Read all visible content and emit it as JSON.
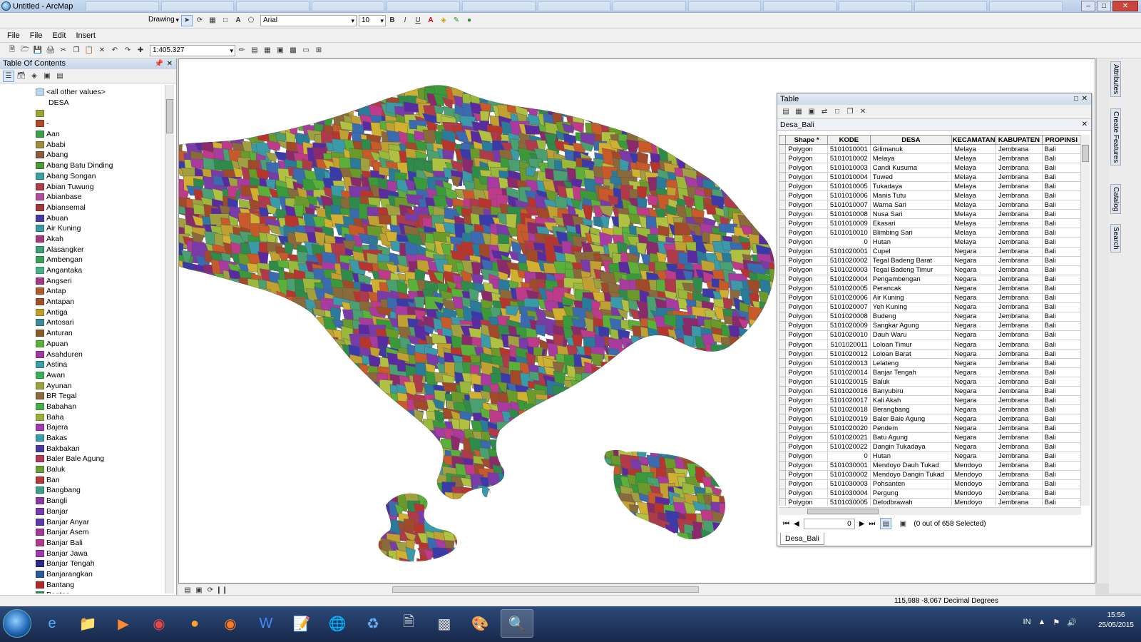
{
  "window": {
    "title": "Untitled - ArcMap"
  },
  "drawing_toolbar": {
    "drawing_label": "Drawing",
    "font_name": "Arial",
    "font_size": "10",
    "bold": "B",
    "italic": "I",
    "underline": "U",
    "text_tool": "A"
  },
  "menu": {
    "items": [
      "File",
      "File",
      "Edit",
      "Insert"
    ]
  },
  "standard_toolbar": {
    "scale": "1:405.327"
  },
  "toc": {
    "title": "Table Of Contents",
    "header_value": "<all other values>",
    "field_name": "DESA",
    "items": [
      {
        "label": "",
        "color": "#9aa53a"
      },
      {
        "label": "-",
        "color": "#b04a2a"
      },
      {
        "label": "Aan",
        "color": "#3aa04a"
      },
      {
        "label": "Ababi",
        "color": "#9a8a3a"
      },
      {
        "label": "Abang",
        "color": "#8a5a3a"
      },
      {
        "label": "Abang Batu Dinding",
        "color": "#4a9a3a"
      },
      {
        "label": "Abang Songan",
        "color": "#3aa0a0"
      },
      {
        "label": "Abian Tuwung",
        "color": "#b03a4a"
      },
      {
        "label": "Abianbase",
        "color": "#b04a9a"
      },
      {
        "label": "Abiansemal",
        "color": "#a03a3a"
      },
      {
        "label": "Abuan",
        "color": "#4a3aa8"
      },
      {
        "label": "Air Kuning",
        "color": "#3a9aa0"
      },
      {
        "label": "Akah",
        "color": "#a03a7a"
      },
      {
        "label": "Alasangker",
        "color": "#3aa07a"
      },
      {
        "label": "Ambengan",
        "color": "#3aa05a"
      },
      {
        "label": "Angantaka",
        "color": "#4ab08a"
      },
      {
        "label": "Angseri",
        "color": "#a03a8a"
      },
      {
        "label": "Antap",
        "color": "#b05a2a"
      },
      {
        "label": "Antapan",
        "color": "#a0502a"
      },
      {
        "label": "Antiga",
        "color": "#c0a02a"
      },
      {
        "label": "Antosari",
        "color": "#3a8a9a"
      },
      {
        "label": "Anturan",
        "color": "#8a5a2a"
      },
      {
        "label": "Apuan",
        "color": "#5ab03a"
      },
      {
        "label": "Asahduren",
        "color": "#a03aa0"
      },
      {
        "label": "Astina",
        "color": "#3aa0a8"
      },
      {
        "label": "Awan",
        "color": "#3ab05a"
      },
      {
        "label": "Ayunan",
        "color": "#9aa03a"
      },
      {
        "label": "BR Tegal",
        "color": "#8a6a3a"
      },
      {
        "label": "Babahan",
        "color": "#4ab04a"
      },
      {
        "label": "Baha",
        "color": "#9ab03a"
      },
      {
        "label": "Bajera",
        "color": "#a03ab0"
      },
      {
        "label": "Bakas",
        "color": "#3a9ab0"
      },
      {
        "label": "Bakbakan",
        "color": "#4a3a9a"
      },
      {
        "label": "Baler Bale Agung",
        "color": "#b03a5a"
      },
      {
        "label": "Baluk",
        "color": "#6aa03a"
      },
      {
        "label": "Ban",
        "color": "#b03a3a"
      },
      {
        "label": "Bangbang",
        "color": "#3aa08a"
      },
      {
        "label": "Bangli",
        "color": "#8a3aa0"
      },
      {
        "label": "Banjar",
        "color": "#7a3ab0"
      },
      {
        "label": "Banjar Anyar",
        "color": "#5a3ab0"
      },
      {
        "label": "Banjar Asem",
        "color": "#a03a9a"
      },
      {
        "label": "Banjar Bali",
        "color": "#b03a8a"
      },
      {
        "label": "Banjar Jawa",
        "color": "#a03ab0"
      },
      {
        "label": "Banjar Tengah",
        "color": "#2a2a8a"
      },
      {
        "label": "Banjarangkan",
        "color": "#2a5a9a"
      },
      {
        "label": "Bantang",
        "color": "#b02a2a"
      },
      {
        "label": "Bantas",
        "color": "#3a8a5a"
      }
    ]
  },
  "table": {
    "title": "Table",
    "tab_name": "Desa_Bali",
    "columns": [
      "Shape *",
      "KODE",
      "DESA",
      "KECAMATAN",
      "KABUPATEN",
      "PROPINSI"
    ],
    "rows": [
      [
        "Polygon",
        "5101010001",
        "Gilimanuk",
        "Melaya",
        "Jembrana",
        "Bali"
      ],
      [
        "Polygon",
        "5101010002",
        "Melaya",
        "Melaya",
        "Jembrana",
        "Bali"
      ],
      [
        "Polygon",
        "5101010003",
        "Candi Kusuma",
        "Melaya",
        "Jembrana",
        "Bali"
      ],
      [
        "Polygon",
        "5101010004",
        "Tuwed",
        "Melaya",
        "Jembrana",
        "Bali"
      ],
      [
        "Polygon",
        "5101010005",
        "Tukadaya",
        "Melaya",
        "Jembrana",
        "Bali"
      ],
      [
        "Polygon",
        "5101010006",
        "Manis Tutu",
        "Melaya",
        "Jembrana",
        "Bali"
      ],
      [
        "Polygon",
        "5101010007",
        "Warna Sari",
        "Melaya",
        "Jembrana",
        "Bali"
      ],
      [
        "Polygon",
        "5101010008",
        "Nusa Sari",
        "Melaya",
        "Jembrana",
        "Bali"
      ],
      [
        "Polygon",
        "5101010009",
        "Ekasari",
        "Melaya",
        "Jembrana",
        "Bali"
      ],
      [
        "Polygon",
        "5101010010",
        "Blimbing Sari",
        "Melaya",
        "Jembrana",
        "Bali"
      ],
      [
        "Polygon",
        "0",
        "Hutan",
        "Melaya",
        "Jembrana",
        "Bali"
      ],
      [
        "Polygon",
        "5101020001",
        "Cupel",
        "Negara",
        "Jembrana",
        "Bali"
      ],
      [
        "Polygon",
        "5101020002",
        "Tegal Badeng Barat",
        "Negara",
        "Jembrana",
        "Bali"
      ],
      [
        "Polygon",
        "5101020003",
        "Tegal Badeng Timur",
        "Negara",
        "Jembrana",
        "Bali"
      ],
      [
        "Polygon",
        "5101020004",
        "Pengambengan",
        "Negara",
        "Jembrana",
        "Bali"
      ],
      [
        "Polygon",
        "5101020005",
        "Perancak",
        "Negara",
        "Jembrana",
        "Bali"
      ],
      [
        "Polygon",
        "5101020006",
        "Air Kuning",
        "Negara",
        "Jembrana",
        "Bali"
      ],
      [
        "Polygon",
        "5101020007",
        "Yeh Kuning",
        "Negara",
        "Jembrana",
        "Bali"
      ],
      [
        "Polygon",
        "5101020008",
        "Budeng",
        "Negara",
        "Jembrana",
        "Bali"
      ],
      [
        "Polygon",
        "5101020009",
        "Sangkar Agung",
        "Negara",
        "Jembrana",
        "Bali"
      ],
      [
        "Polygon",
        "5101020010",
        "Dauh Waru",
        "Negara",
        "Jembrana",
        "Bali"
      ],
      [
        "Polygon",
        "5101020011",
        "Loloan Timur",
        "Negara",
        "Jembrana",
        "Bali"
      ],
      [
        "Polygon",
        "5101020012",
        "Loloan Barat",
        "Negara",
        "Jembrana",
        "Bali"
      ],
      [
        "Polygon",
        "5101020013",
        "Lelateng",
        "Negara",
        "Jembrana",
        "Bali"
      ],
      [
        "Polygon",
        "5101020014",
        "Banjar Tengah",
        "Negara",
        "Jembrana",
        "Bali"
      ],
      [
        "Polygon",
        "5101020015",
        "Baluk",
        "Negara",
        "Jembrana",
        "Bali"
      ],
      [
        "Polygon",
        "5101020016",
        "Banyubiru",
        "Negara",
        "Jembrana",
        "Bali"
      ],
      [
        "Polygon",
        "5101020017",
        "Kali Akah",
        "Negara",
        "Jembrana",
        "Bali"
      ],
      [
        "Polygon",
        "5101020018",
        "Berangbang",
        "Negara",
        "Jembrana",
        "Bali"
      ],
      [
        "Polygon",
        "5101020019",
        "Baler Bale Agung",
        "Negara",
        "Jembrana",
        "Bali"
      ],
      [
        "Polygon",
        "5101020020",
        "Pendem",
        "Negara",
        "Jembrana",
        "Bali"
      ],
      [
        "Polygon",
        "5101020021",
        "Batu Agung",
        "Negara",
        "Jembrana",
        "Bali"
      ],
      [
        "Polygon",
        "5101020022",
        "Dangin Tukadaya",
        "Negara",
        "Jembrana",
        "Bali"
      ],
      [
        "Polygon",
        "0",
        "Hutan",
        "Negara",
        "Jembrana",
        "Bali"
      ],
      [
        "Polygon",
        "5101030001",
        "Mendoyo Dauh Tukad",
        "Mendoyo",
        "Jembrana",
        "Bali"
      ],
      [
        "Polygon",
        "5101030002",
        "Mendoyo Dangin Tukad",
        "Mendoyo",
        "Jembrana",
        "Bali"
      ],
      [
        "Polygon",
        "5101030003",
        "Pohsanten",
        "Mendoyo",
        "Jembrana",
        "Bali"
      ],
      [
        "Polygon",
        "5101030004",
        "Pergung",
        "Mendoyo",
        "Jembrana",
        "Bali"
      ],
      [
        "Polygon",
        "5101030005",
        "Delodbrawah",
        "Mendoyo",
        "Jembrana",
        "Bali"
      ]
    ],
    "record": "0",
    "selection": "(0 out of 658 Selected)"
  },
  "dock": {
    "tabs": [
      "Attributes",
      "Create Features",
      "Catalog",
      "Search"
    ]
  },
  "status": {
    "coords": "115,988  -8,067 Decimal Degrees"
  },
  "taskbar": {
    "lang": "IN",
    "time": "15:56",
    "date": "25/05/2015"
  },
  "map": {
    "palette": [
      "#3a9a3a",
      "#5ab038",
      "#2e8b4a",
      "#9ab83a",
      "#c0a030",
      "#a04a2a",
      "#b8352e",
      "#7a3aa8",
      "#5a2aa0",
      "#3a3aa8",
      "#a83aa0",
      "#c03a8a",
      "#3a9aa8",
      "#2a7a9a",
      "#8a6a3a",
      "#6a9a2a",
      "#b0c040",
      "#a0a040",
      "#d0b030",
      "#4aa070",
      "#8a2a6a",
      "#c85a2a",
      "#3a6ab0",
      "#b03a4a"
    ]
  }
}
